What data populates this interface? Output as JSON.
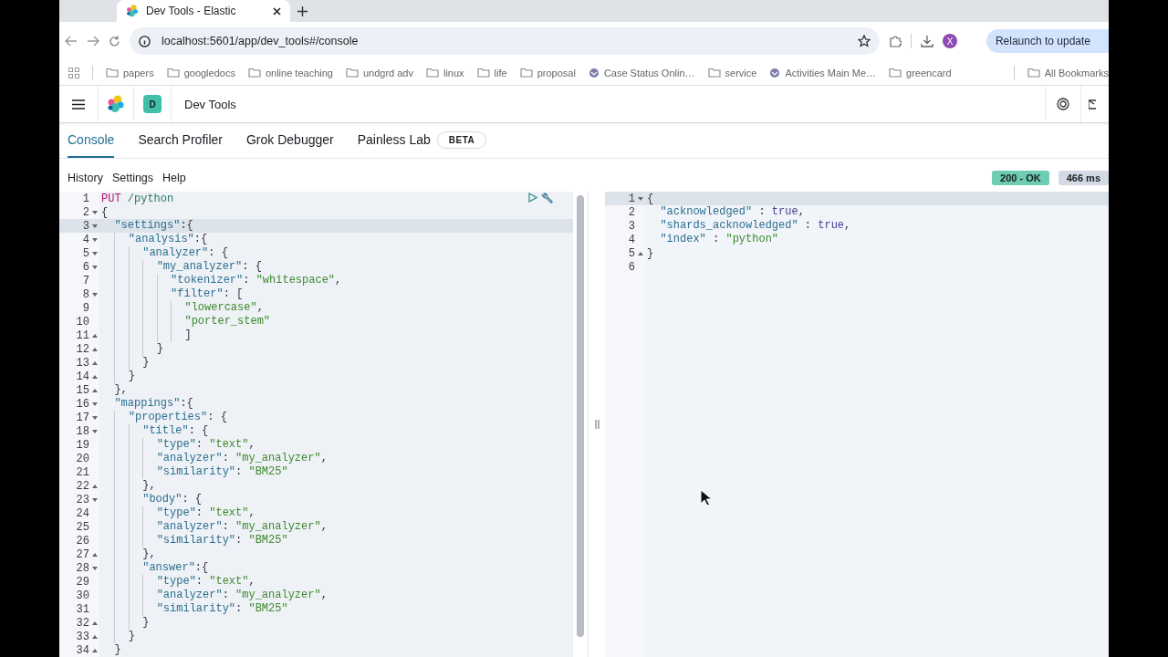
{
  "browser": {
    "tab": {
      "title": "Dev Tools - Elastic"
    },
    "url": "localhost:5601/app/dev_tools#/console",
    "avatar_letter": "X",
    "relaunch_label": "Relaunch to update",
    "bookmarks": [
      {
        "label": "papers",
        "kind": "folder"
      },
      {
        "label": "googledocs",
        "kind": "folder"
      },
      {
        "label": "online teaching",
        "kind": "folder"
      },
      {
        "label": "undgrd adv",
        "kind": "folder"
      },
      {
        "label": "linux",
        "kind": "folder"
      },
      {
        "label": "life",
        "kind": "folder"
      },
      {
        "label": "proposal",
        "kind": "folder"
      },
      {
        "label": "Case Status Onlin…",
        "kind": "site"
      },
      {
        "label": "service",
        "kind": "folder"
      },
      {
        "label": "Activities Main Me…",
        "kind": "site"
      },
      {
        "label": "greencard",
        "kind": "folder"
      }
    ],
    "all_bookmarks_label": "All Bookmarks"
  },
  "header": {
    "space_letter": "D",
    "title": "Dev Tools"
  },
  "tabs": [
    {
      "label": "Console",
      "selected": true
    },
    {
      "label": "Search Profiler",
      "selected": false
    },
    {
      "label": "Grok Debugger",
      "selected": false
    },
    {
      "label": "Painless Lab",
      "selected": false,
      "badge": "BETA"
    }
  ],
  "toolbar": [
    "History",
    "Settings",
    "Help"
  ],
  "status": {
    "code": "200 - OK",
    "time": "466 ms"
  },
  "request_editor": {
    "lines": [
      {
        "number": "1",
        "fold_open": false,
        "fold_close": false,
        "active": false,
        "tokens": [
          {
            "kind": "method",
            "text": "PUT"
          },
          {
            "kind": "path",
            "text": " /python"
          }
        ]
      },
      {
        "number": "2",
        "fold_open": true,
        "fold_close": false,
        "active": false,
        "tokens": [
          {
            "kind": "punct",
            "text": "{"
          }
        ]
      },
      {
        "number": "3",
        "fold_open": true,
        "fold_close": false,
        "active": true,
        "tokens": [
          {
            "kind": "key",
            "text": "  \"settings\""
          },
          {
            "kind": "punct",
            "text": ":{"
          }
        ]
      },
      {
        "number": "4",
        "fold_open": true,
        "fold_close": false,
        "active": false,
        "tokens": [
          {
            "kind": "key",
            "text": "    \"analysis\""
          },
          {
            "kind": "punct",
            "text": ":{"
          }
        ]
      },
      {
        "number": "5",
        "fold_open": true,
        "fold_close": false,
        "active": false,
        "tokens": [
          {
            "kind": "key",
            "text": "      \"analyzer\""
          },
          {
            "kind": "punct",
            "text": ": {"
          }
        ]
      },
      {
        "number": "6",
        "fold_open": true,
        "fold_close": false,
        "active": false,
        "tokens": [
          {
            "kind": "key",
            "text": "        \"my_analyzer\""
          },
          {
            "kind": "punct",
            "text": ": {"
          }
        ]
      },
      {
        "number": "7",
        "fold_open": false,
        "fold_close": false,
        "active": false,
        "tokens": [
          {
            "kind": "key",
            "text": "          \"tokenizer\""
          },
          {
            "kind": "punct",
            "text": ": "
          },
          {
            "kind": "string",
            "text": "\"whitespace\""
          },
          {
            "kind": "punct",
            "text": ","
          }
        ]
      },
      {
        "number": "8",
        "fold_open": true,
        "fold_close": false,
        "active": false,
        "tokens": [
          {
            "kind": "key",
            "text": "          \"filter\""
          },
          {
            "kind": "punct",
            "text": ": ["
          }
        ]
      },
      {
        "number": "9",
        "fold_open": false,
        "fold_close": false,
        "active": false,
        "tokens": [
          {
            "kind": "string",
            "text": "            \"lowercase\""
          },
          {
            "kind": "punct",
            "text": ","
          }
        ]
      },
      {
        "number": "10",
        "fold_open": false,
        "fold_close": false,
        "active": false,
        "tokens": [
          {
            "kind": "string",
            "text": "            \"porter_stem\""
          }
        ]
      },
      {
        "number": "11",
        "fold_open": false,
        "fold_close": true,
        "active": false,
        "tokens": [
          {
            "kind": "punct",
            "text": "            ]"
          }
        ]
      },
      {
        "number": "12",
        "fold_open": false,
        "fold_close": true,
        "active": false,
        "tokens": [
          {
            "kind": "punct",
            "text": "        }"
          }
        ]
      },
      {
        "number": "13",
        "fold_open": false,
        "fold_close": true,
        "active": false,
        "tokens": [
          {
            "kind": "punct",
            "text": "      }"
          }
        ]
      },
      {
        "number": "14",
        "fold_open": false,
        "fold_close": true,
        "active": false,
        "tokens": [
          {
            "kind": "punct",
            "text": "    }"
          }
        ]
      },
      {
        "number": "15",
        "fold_open": false,
        "fold_close": true,
        "active": false,
        "tokens": [
          {
            "kind": "punct",
            "text": "  },"
          }
        ]
      },
      {
        "number": "16",
        "fold_open": true,
        "fold_close": false,
        "active": false,
        "tokens": [
          {
            "kind": "key",
            "text": "  \"mappings\""
          },
          {
            "kind": "punct",
            "text": ":{"
          }
        ]
      },
      {
        "number": "17",
        "fold_open": true,
        "fold_close": false,
        "active": false,
        "tokens": [
          {
            "kind": "key",
            "text": "    \"properties\""
          },
          {
            "kind": "punct",
            "text": ": {"
          }
        ]
      },
      {
        "number": "18",
        "fold_open": true,
        "fold_close": false,
        "active": false,
        "tokens": [
          {
            "kind": "key",
            "text": "      \"title\""
          },
          {
            "kind": "punct",
            "text": ": {"
          }
        ]
      },
      {
        "number": "19",
        "fold_open": false,
        "fold_close": false,
        "active": false,
        "tokens": [
          {
            "kind": "key",
            "text": "        \"type\""
          },
          {
            "kind": "punct",
            "text": ": "
          },
          {
            "kind": "string",
            "text": "\"text\""
          },
          {
            "kind": "punct",
            "text": ","
          }
        ]
      },
      {
        "number": "20",
        "fold_open": false,
        "fold_close": false,
        "active": false,
        "tokens": [
          {
            "kind": "key",
            "text": "        \"analyzer\""
          },
          {
            "kind": "punct",
            "text": ": "
          },
          {
            "kind": "string",
            "text": "\"my_analyzer\""
          },
          {
            "kind": "punct",
            "text": ","
          }
        ]
      },
      {
        "number": "21",
        "fold_open": false,
        "fold_close": false,
        "active": false,
        "tokens": [
          {
            "kind": "key",
            "text": "        \"similarity\""
          },
          {
            "kind": "punct",
            "text": ": "
          },
          {
            "kind": "string",
            "text": "\"BM25\""
          }
        ]
      },
      {
        "number": "22",
        "fold_open": false,
        "fold_close": true,
        "active": false,
        "tokens": [
          {
            "kind": "punct",
            "text": "      },"
          }
        ]
      },
      {
        "number": "23",
        "fold_open": true,
        "fold_close": false,
        "active": false,
        "tokens": [
          {
            "kind": "key",
            "text": "      \"body\""
          },
          {
            "kind": "punct",
            "text": ": {"
          }
        ]
      },
      {
        "number": "24",
        "fold_open": false,
        "fold_close": false,
        "active": false,
        "tokens": [
          {
            "kind": "key",
            "text": "        \"type\""
          },
          {
            "kind": "punct",
            "text": ": "
          },
          {
            "kind": "string",
            "text": "\"text\""
          },
          {
            "kind": "punct",
            "text": ","
          }
        ]
      },
      {
        "number": "25",
        "fold_open": false,
        "fold_close": false,
        "active": false,
        "tokens": [
          {
            "kind": "key",
            "text": "        \"analyzer\""
          },
          {
            "kind": "punct",
            "text": ": "
          },
          {
            "kind": "string",
            "text": "\"my_analyzer\""
          },
          {
            "kind": "punct",
            "text": ","
          }
        ]
      },
      {
        "number": "26",
        "fold_open": false,
        "fold_close": false,
        "active": false,
        "tokens": [
          {
            "kind": "key",
            "text": "        \"similarity\""
          },
          {
            "kind": "punct",
            "text": ": "
          },
          {
            "kind": "string",
            "text": "\"BM25\""
          }
        ]
      },
      {
        "number": "27",
        "fold_open": false,
        "fold_close": true,
        "active": false,
        "tokens": [
          {
            "kind": "punct",
            "text": "      },"
          }
        ]
      },
      {
        "number": "28",
        "fold_open": true,
        "fold_close": false,
        "active": false,
        "tokens": [
          {
            "kind": "key",
            "text": "      \"answer\""
          },
          {
            "kind": "punct",
            "text": ":{"
          }
        ]
      },
      {
        "number": "29",
        "fold_open": false,
        "fold_close": false,
        "active": false,
        "tokens": [
          {
            "kind": "key",
            "text": "        \"type\""
          },
          {
            "kind": "punct",
            "text": ": "
          },
          {
            "kind": "string",
            "text": "\"text\""
          },
          {
            "kind": "punct",
            "text": ","
          }
        ]
      },
      {
        "number": "30",
        "fold_open": false,
        "fold_close": false,
        "active": false,
        "tokens": [
          {
            "kind": "key",
            "text": "        \"analyzer\""
          },
          {
            "kind": "punct",
            "text": ": "
          },
          {
            "kind": "string",
            "text": "\"my_analyzer\""
          },
          {
            "kind": "punct",
            "text": ","
          }
        ]
      },
      {
        "number": "31",
        "fold_open": false,
        "fold_close": false,
        "active": false,
        "tokens": [
          {
            "kind": "key",
            "text": "        \"similarity\""
          },
          {
            "kind": "punct",
            "text": ": "
          },
          {
            "kind": "string",
            "text": "\"BM25\""
          }
        ]
      },
      {
        "number": "32",
        "fold_open": false,
        "fold_close": true,
        "active": false,
        "tokens": [
          {
            "kind": "punct",
            "text": "      }"
          }
        ]
      },
      {
        "number": "33",
        "fold_open": false,
        "fold_close": true,
        "active": false,
        "tokens": [
          {
            "kind": "punct",
            "text": "    }"
          }
        ]
      },
      {
        "number": "34",
        "fold_open": false,
        "fold_close": true,
        "active": false,
        "tokens": [
          {
            "kind": "punct",
            "text": "  }"
          }
        ]
      }
    ]
  },
  "response_editor": {
    "lines": [
      {
        "number": "1",
        "fold_open": true,
        "fold_close": false,
        "active": true,
        "tokens": [
          {
            "kind": "punct",
            "text": "{"
          }
        ]
      },
      {
        "number": "2",
        "fold_open": false,
        "fold_close": false,
        "active": false,
        "tokens": [
          {
            "kind": "key",
            "text": "  \"acknowledged\""
          },
          {
            "kind": "punct",
            "text": " : "
          },
          {
            "kind": "bool",
            "text": "true"
          },
          {
            "kind": "punct",
            "text": ","
          }
        ]
      },
      {
        "number": "3",
        "fold_open": false,
        "fold_close": false,
        "active": false,
        "tokens": [
          {
            "kind": "key",
            "text": "  \"shards_acknowledged\""
          },
          {
            "kind": "punct",
            "text": " : "
          },
          {
            "kind": "bool",
            "text": "true"
          },
          {
            "kind": "punct",
            "text": ","
          }
        ]
      },
      {
        "number": "4",
        "fold_open": false,
        "fold_close": false,
        "active": false,
        "tokens": [
          {
            "kind": "key",
            "text": "  \"index\""
          },
          {
            "kind": "punct",
            "text": " : "
          },
          {
            "kind": "string",
            "text": "\"python\""
          }
        ]
      },
      {
        "number": "5",
        "fold_open": false,
        "fold_close": true,
        "active": false,
        "tokens": [
          {
            "kind": "punct",
            "text": "}"
          }
        ]
      },
      {
        "number": "6",
        "fold_open": false,
        "fold_close": false,
        "active": false
      }
    ]
  }
}
